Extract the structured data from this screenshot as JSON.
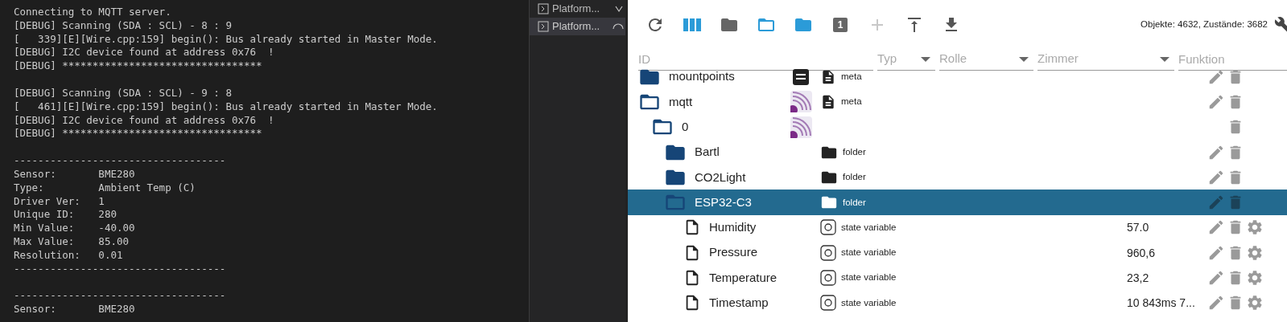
{
  "terminal": {
    "blocks": [
      [
        "Connecting to MQTT server.",
        "[DEBUG] Scanning (SDA : SCL) - 8 : 9",
        "[   339][E][Wire.cpp:159] begin(): Bus already started in Master Mode.",
        "[DEBUG] I2C device found at address 0x76  !",
        "[DEBUG] *********************************"
      ],
      [
        "[DEBUG] Scanning (SDA : SCL) - 9 : 8",
        "[   461][E][Wire.cpp:159] begin(): Bus already started in Master Mode.",
        "[DEBUG] I2C device found at address 0x76  !",
        "[DEBUG] *********************************"
      ],
      [
        "-----------------------------------",
        "Sensor:       BME280",
        "Type:         Ambient Temp (C)",
        "Driver Ver:   1",
        "Unique ID:    280",
        "Min Value:    -40.00",
        "Max Value:    85.00",
        "Resolution:   0.01",
        "-----------------------------------"
      ],
      [
        "-----------------------------------",
        "Sensor:       BME280"
      ]
    ]
  },
  "terminal_list": [
    {
      "label": "Platform...",
      "selected": false,
      "kind": "chevron"
    },
    {
      "label": "Platform...",
      "selected": true,
      "kind": "spinner"
    }
  ],
  "toolbar": {
    "buttons": [
      {
        "kind": "refresh",
        "disabled": false
      },
      {
        "kind": "columns",
        "disabled": false
      },
      {
        "kind": "collapse",
        "disabled": false
      },
      {
        "kind": "expand",
        "disabled": false
      },
      {
        "kind": "expand-level",
        "disabled": false
      },
      {
        "kind": "number",
        "label": "1",
        "disabled": false
      },
      {
        "kind": "add",
        "disabled": true
      },
      {
        "kind": "upload",
        "disabled": false
      },
      {
        "kind": "download",
        "disabled": false
      }
    ],
    "status": "Objekte: 4632, Zustände: 3682"
  },
  "filters": [
    {
      "kind": "text",
      "placeholder": "ID"
    },
    {
      "kind": "select",
      "placeholder": "Typ"
    },
    {
      "kind": "select",
      "placeholder": "Rolle"
    },
    {
      "kind": "select",
      "placeholder": "Zimmer"
    },
    {
      "kind": "text",
      "placeholder": "Funktion"
    }
  ],
  "tree": [
    {
      "name": "mountpoints",
      "expanded": false,
      "selected": false,
      "logo": {
        "kind": "list"
      },
      "type": {
        "kind": "meta",
        "label": "meta"
      },
      "editable": true,
      "settings": false
    },
    {
      "name": "mqtt",
      "expanded": true,
      "selected": false,
      "logo": {
        "kind": "adapter"
      },
      "type": {
        "kind": "meta",
        "label": "meta"
      },
      "editable": true,
      "settings": false,
      "children": [
        {
          "name": "0",
          "expanded": true,
          "selected": false,
          "logo": {
            "kind": "adapter"
          },
          "editable": false,
          "settings": false,
          "children": [
            {
              "name": "Bartl",
              "expanded": false,
              "selected": false,
              "type": {
                "kind": "folder",
                "label": "folder"
              },
              "editable": true,
              "settings": false
            },
            {
              "name": "CO2Light",
              "expanded": false,
              "selected": false,
              "type": {
                "kind": "folder",
                "label": "folder"
              },
              "editable": true,
              "settings": false
            },
            {
              "name": "ESP32-C3",
              "expanded": true,
              "selected": true,
              "type": {
                "kind": "folder",
                "label": "folder"
              },
              "editable": true,
              "settings": false,
              "children": [
                {
                  "name": "Humidity",
                  "kind": "state",
                  "selected": false,
                  "type": {
                    "kind": "state",
                    "label": "state variable"
                  },
                  "value": "57.0",
                  "editable": true,
                  "settings": true
                },
                {
                  "name": "Pressure",
                  "kind": "state",
                  "selected": false,
                  "type": {
                    "kind": "state",
                    "label": "state variable"
                  },
                  "value": "960,6",
                  "editable": true,
                  "settings": true
                },
                {
                  "name": "Temperature",
                  "kind": "state",
                  "selected": false,
                  "type": {
                    "kind": "state",
                    "label": "state variable"
                  },
                  "value": "23,2",
                  "editable": true,
                  "settings": true
                },
                {
                  "name": "Timestamp",
                  "kind": "state",
                  "selected": false,
                  "type": {
                    "kind": "state",
                    "label": "state variable"
                  },
                  "value": "10 843ms 7...",
                  "editable": true,
                  "settings": true
                }
              ]
            }
          ]
        }
      ]
    }
  ]
}
